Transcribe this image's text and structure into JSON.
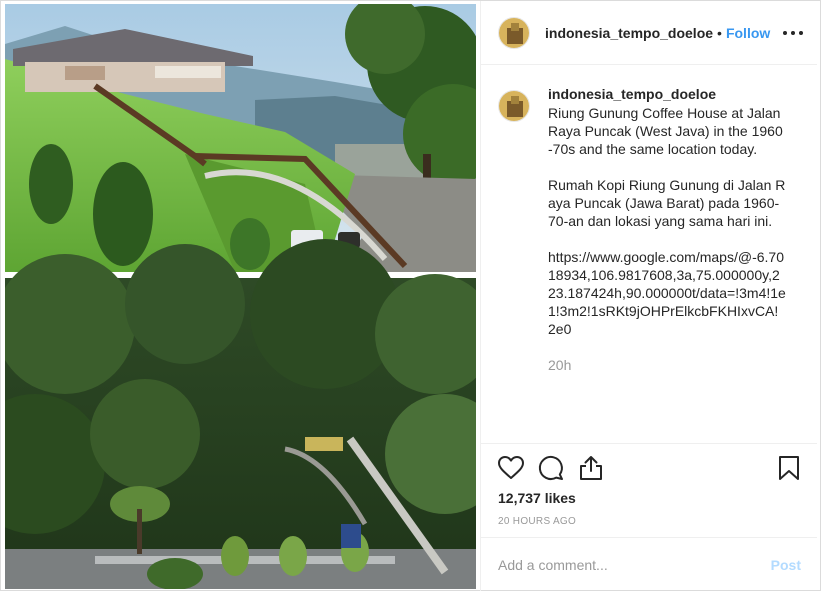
{
  "post": {
    "username": "indonesia_tempo_doeloe",
    "header_separator": "•",
    "follow_label": "Follow",
    "more_icon": "more-options-icon"
  },
  "caption": {
    "username": "indonesia_tempo_doeloe",
    "paragraphs": [
      "Riung Gunung Coffee House at Jalan Raya Puncak (West Java) in the 1960-70s and the same location today.",
      "Rumah Kopi Riung Gunung di Jalan Raya Puncak (Jawa Barat) pada 1960-70-an dan lokasi yang sama hari ini.",
      "https://www.google.com/maps/@-6.7018934,106.9817608,3a,75.000000y,223.187424h,90.000000t/data=!3m4!1e1!3m2!1sRKt9jOHPrElkcbFKHIxvCA!2e0"
    ],
    "time": "20h"
  },
  "actions": {
    "icons": [
      "heart-icon",
      "comment-icon",
      "share-icon",
      "bookmark-icon"
    ],
    "likes": "12,737 likes",
    "posted": "20 HOURS AGO"
  },
  "add_comment": {
    "placeholder": "Add a comment...",
    "post_label": "Post"
  },
  "colors": {
    "link_blue": "#3897f0",
    "post_disabled": "#b3dbff",
    "muted": "#999999",
    "text": "#262626",
    "border": "#efefef"
  }
}
